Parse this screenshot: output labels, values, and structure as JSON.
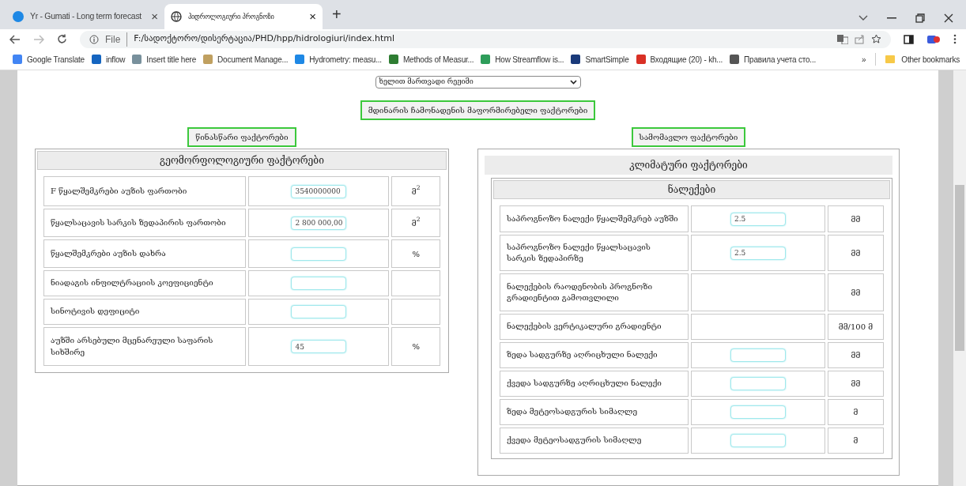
{
  "browser": {
    "tabs": [
      {
        "title": "Yr - Gumati - Long term forecast",
        "selected": false,
        "close": "×"
      },
      {
        "title": "ჰიდროლოგიური პროგნოზი",
        "selected": true,
        "close": "×"
      }
    ],
    "new_tab": "+",
    "address": {
      "scheme": "File",
      "url": "F:/სადოქტორო/დისერტაცია/PHD/hpp/hidrologiuri/index.html"
    },
    "bookmarks": [
      "Google Translate",
      "inflow",
      "Insert title here",
      "Document Manage...",
      "Hydrometry: measu...",
      "Methods of Measur...",
      "How Streamflow is...",
      "SmartSimple",
      "Входящие (20) - kh...",
      "Правила учета сто..."
    ],
    "more_bookmarks": "»",
    "other_bookmarks": "Other bookmarks"
  },
  "mode_select": {
    "value": "ხელით მართვადი რეჟიმი"
  },
  "heading": "მდინარის ჩამონადენის მაფორმირებელი ფაქტორები",
  "left": {
    "label": "წინასწარი ფაქტორები",
    "title": "გეომორფოლოგიური ფაქტორები",
    "rows": [
      {
        "label": "F წყალშემკრები აუზის ფართობი",
        "kind": "input",
        "value": "3540000000",
        "unit": "მ$^{2}$"
      },
      {
        "label": "წყალსაცავის სარკის ზედაპირის ფართობი",
        "kind": "input",
        "value": "2 800 000,00",
        "unit": "მ$^{2}$"
      },
      {
        "label": "წყალშემკრები აუზის დახრა",
        "kind": "input",
        "unit": "%"
      },
      {
        "label": "ნიადაგის ინფილტრაციის კოეფიციენტი",
        "kind": "input"
      },
      {
        "label": "სინოტივის დეფიციტი",
        "kind": "input"
      },
      {
        "label": "აუზში არსებული მცენარეული საფარის სიხშირე",
        "kind": "input",
        "value": "45",
        "unit": "%"
      }
    ]
  },
  "right": {
    "label": "სამომავლო ფაქტორები",
    "title": "კლიმატური ფაქტორები",
    "subtitle": "ნალექები",
    "rows": [
      {
        "label": "საპროგნოზო ნალექი წყალშემკრებ აუზში",
        "kind": "input",
        "value": "2.5",
        "unit": "მმ"
      },
      {
        "label": "საპროგნოზო ნალექი წყალსაცავის სარკის ზედაპირზე",
        "kind": "input",
        "value": "2.5",
        "unit": "მმ"
      },
      {
        "label": "ნალექების რაოდენობის პროგნოზი გრადიენტით გამოთვლილი",
        "kind": "output",
        "unit": "მმ"
      },
      {
        "label": "ნალექების ვერტიკალური გრადიენტი",
        "kind": "output",
        "unit": "მმ/100 მ"
      },
      {
        "label": "ზედა სადგურზე აღრიცხული ნალექი",
        "kind": "input",
        "unit": "მმ"
      },
      {
        "label": "ქვედა სადგურზე აღრიცხული ნალექი",
        "kind": "input",
        "unit": "მმ"
      },
      {
        "label": "ზედა მეტეოსადგურის სიმაღლე",
        "kind": "input",
        "unit": "მ"
      },
      {
        "label": "ქვედა მეტეოსადგურის სიმაღლე",
        "kind": "input",
        "unit": "მ"
      }
    ]
  }
}
